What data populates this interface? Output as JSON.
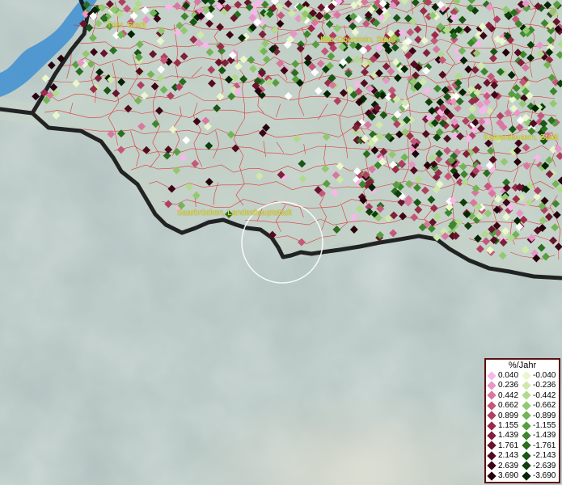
{
  "map": {
    "places": [
      {
        "id": "trier",
        "label": "Trier, Stadt"
      },
      {
        "id": "idar",
        "label": "Idar-Oberstein, Stadt"
      },
      {
        "id": "kaiserslautern",
        "label": "Kaiserslautern, Stadt"
      },
      {
        "id": "saarbruecken",
        "label": "Saarbrücken, Landeshauptstadt"
      }
    ],
    "colors": {
      "terrain": "#aebfbc",
      "river": "#3d8fd0",
      "border": "#000000",
      "districts": "#e02020",
      "place_label": "#e8e23a",
      "marker_circle": "#ffffff"
    }
  },
  "legend": {
    "title": "%/Jahr",
    "positive": [
      {
        "value": "0.040",
        "color": "#f6b8e8"
      },
      {
        "value": "0.236",
        "color": "#e896c8"
      },
      {
        "value": "0.442",
        "color": "#d8779f"
      },
      {
        "value": "0.662",
        "color": "#c4587a"
      },
      {
        "value": "0.899",
        "color": "#b04060"
      },
      {
        "value": "1.155",
        "color": "#992c48"
      },
      {
        "value": "1.439",
        "color": "#80203a"
      },
      {
        "value": "1.761",
        "color": "#68142c"
      },
      {
        "value": "2.143",
        "color": "#520c20"
      },
      {
        "value": "2.639",
        "color": "#3c0616"
      },
      {
        "value": "3.690",
        "color": "#26020c"
      }
    ],
    "negative": [
      {
        "value": "-0.040",
        "color": "#eaf6cc"
      },
      {
        "value": "-0.236",
        "color": "#cfe9aa"
      },
      {
        "value": "-0.442",
        "color": "#b2da8c"
      },
      {
        "value": "-0.662",
        "color": "#93c870"
      },
      {
        "value": "-0.899",
        "color": "#74b456"
      },
      {
        "value": "-1.155",
        "color": "#579e40"
      },
      {
        "value": "-1.439",
        "color": "#3e862e"
      },
      {
        "value": "-1.761",
        "color": "#2a6e20"
      },
      {
        "value": "-2.143",
        "color": "#1a5614"
      },
      {
        "value": "-2.639",
        "color": "#0e3e0a"
      },
      {
        "value": "-3.690",
        "color": "#042404"
      }
    ]
  }
}
